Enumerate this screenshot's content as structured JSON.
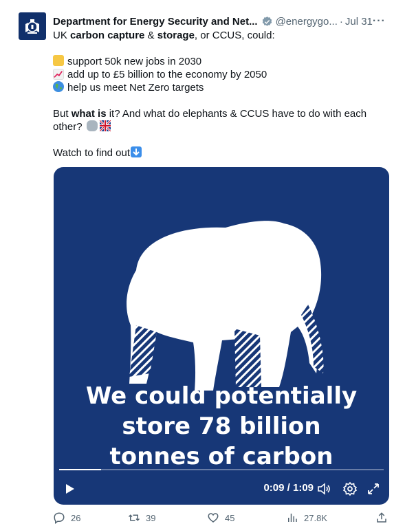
{
  "account": {
    "name": "Department for Energy Security and Net...",
    "handle": "@energygo...",
    "separator": "·",
    "date": "Jul 31",
    "more": "···"
  },
  "tweet": {
    "line1": {
      "pre": "UK ",
      "bold1": "carbon capture",
      "mid": " & ",
      "bold2": "storage",
      "post": ", or CCUS, could:"
    },
    "bullets": [
      {
        "icon": "worker-emoji",
        "text": "support 50k new jobs in 2030"
      },
      {
        "icon": "chart-increasing-emoji",
        "text": "add up to £5 billion to the economy by 2050"
      },
      {
        "icon": "globe-emoji",
        "text": "help us meet Net Zero targets"
      }
    ],
    "question": {
      "pre": "But ",
      "bold": "what is",
      "post": " it? And what do elephants & CCUS have to do with each"
    },
    "question2": "other?",
    "watch": "Watch to find out"
  },
  "video": {
    "caption": [
      "We could potentially",
      "store 78 billion",
      "tonnes of carbon"
    ],
    "time": "0:09 / 1:09",
    "progress": 0.13,
    "background": "#173777"
  },
  "actions": {
    "replies": "26",
    "retweets": "39",
    "likes": "45",
    "views": "27.8K"
  },
  "colors": {
    "text": "#0f1419",
    "muted": "#536471",
    "verified": "#829aab",
    "accent": "#1d9bf0"
  }
}
